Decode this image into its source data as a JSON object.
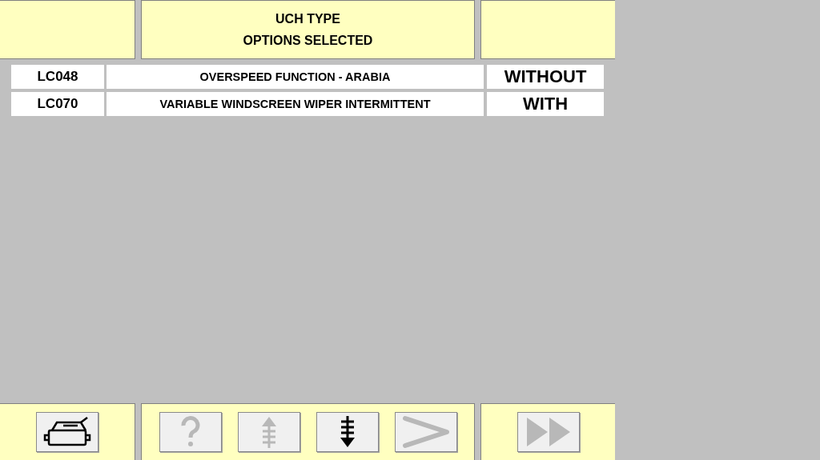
{
  "header": {
    "title_lines": [
      "UCH TYPE",
      "OPTIONS SELECTED"
    ]
  },
  "options": [
    {
      "code": "LC048",
      "description": "OVERSPEED FUNCTION - ARABIA",
      "status": "WITHOUT"
    },
    {
      "code": "LC070",
      "description": "VARIABLE WINDSCREEN WIPER INTERMITTENT",
      "status": "WITH"
    }
  ],
  "toolbar": {
    "left": [
      {
        "kind": "print",
        "disabled": false
      }
    ],
    "center": [
      {
        "kind": "help",
        "disabled": true
      },
      {
        "kind": "scroll-up",
        "disabled": true
      },
      {
        "kind": "scroll-down",
        "disabled": false
      },
      {
        "kind": "next",
        "disabled": true
      }
    ],
    "right": [
      {
        "kind": "fast-forward",
        "disabled": true
      }
    ]
  }
}
